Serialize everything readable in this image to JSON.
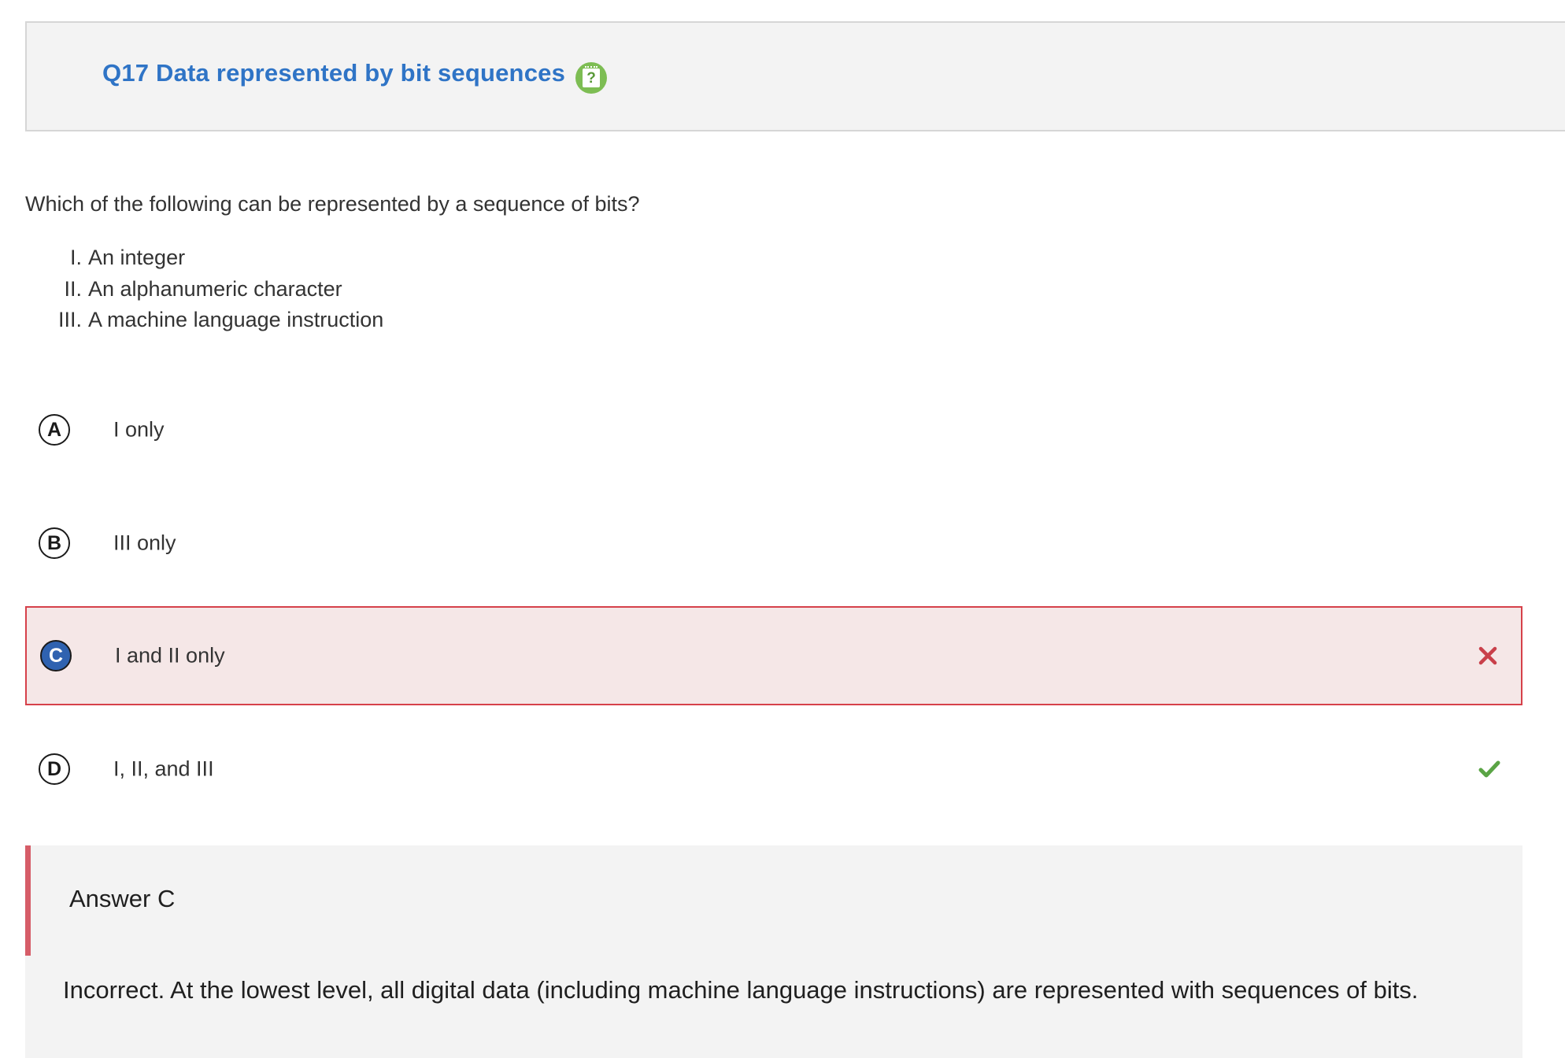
{
  "header": {
    "title": "Q17 Data represented by bit sequences",
    "help_icon": "help-notepad-icon",
    "help_symbol": "?"
  },
  "question": {
    "prompt": "Which of the following can be represented by a sequence of bits?",
    "statements": [
      {
        "num": "I.",
        "text": "An integer"
      },
      {
        "num": "II.",
        "text": "An alphanumeric character"
      },
      {
        "num": "III.",
        "text": "A machine language instruction"
      }
    ]
  },
  "choices": [
    {
      "letter": "A",
      "text": "I only",
      "state": "none"
    },
    {
      "letter": "B",
      "text": "III only",
      "state": "none"
    },
    {
      "letter": "C",
      "text": "I and II only",
      "state": "selected-incorrect",
      "mark": "close-x-icon"
    },
    {
      "letter": "D",
      "text": "I, II, and III",
      "state": "correct",
      "mark": "checkmark-icon"
    }
  ],
  "feedback": {
    "answer_label": "Answer C",
    "explanation": "Incorrect. At the lowest level, all digital data (including machine language instructions) are represented with sequences of bits."
  },
  "colors": {
    "title_blue": "#2f74c6",
    "help_green": "#7dbd53",
    "wrong_red": "#d6414a",
    "wrong_bg": "#f5e7e7",
    "correct_green": "#5aa445",
    "selected_blue": "#2f62b0",
    "feedback_bar": "#d65d68"
  }
}
